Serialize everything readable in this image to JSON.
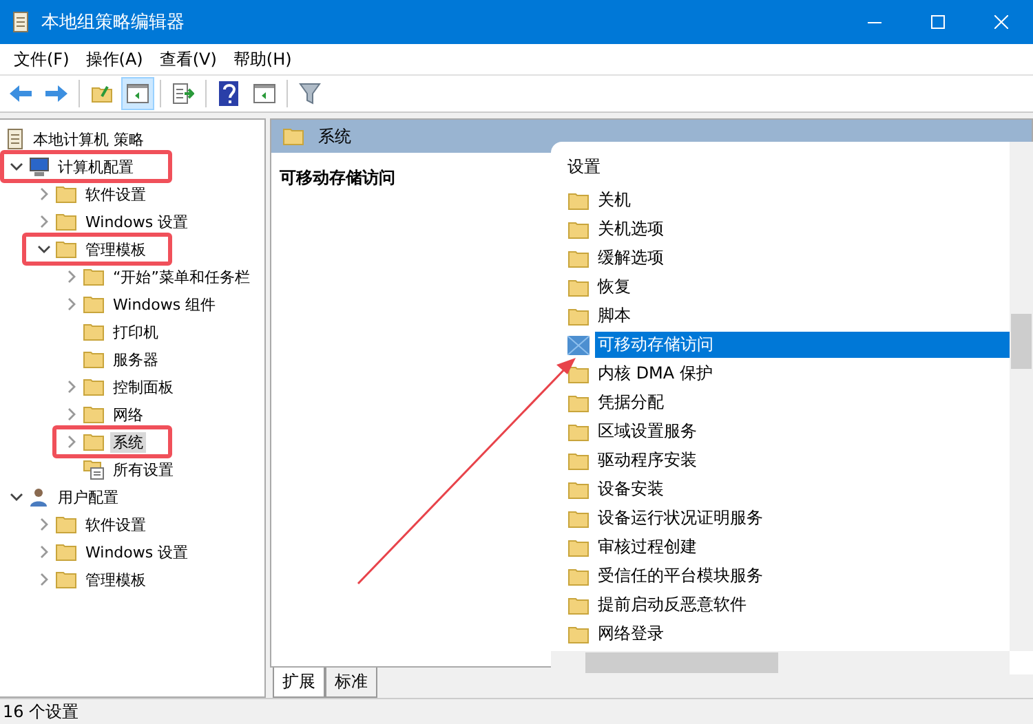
{
  "window": {
    "title": "本地组策略编辑器"
  },
  "menu": [
    "文件(F)",
    "操作(A)",
    "查看(V)",
    "帮助(H)"
  ],
  "toolbar": [
    {
      "kind": "back",
      "pressed": false
    },
    {
      "kind": "forward",
      "pressed": false
    },
    {
      "kind": "sep"
    },
    {
      "kind": "up",
      "pressed": false
    },
    {
      "kind": "pane",
      "pressed": true
    },
    {
      "kind": "sep"
    },
    {
      "kind": "export",
      "pressed": false
    },
    {
      "kind": "sep"
    },
    {
      "kind": "help",
      "pressed": false
    },
    {
      "kind": "pane2",
      "pressed": false
    },
    {
      "kind": "sep"
    },
    {
      "kind": "filter",
      "pressed": false
    }
  ],
  "tree": [
    {
      "label": "本地计算机 策略",
      "kind": "policy",
      "highlighted": false,
      "selected": false,
      "children": [
        {
          "label": "计算机配置",
          "kind": "computer",
          "expanded": true,
          "highlighted": true,
          "selected": false,
          "children": [
            {
              "label": "软件设置",
              "kind": "folder",
              "expanded": false,
              "highlighted": false,
              "selected": false
            },
            {
              "label": "Windows 设置",
              "kind": "folder",
              "expanded": false,
              "highlighted": false,
              "selected": false
            },
            {
              "label": "管理模板",
              "kind": "folder",
              "expanded": true,
              "highlighted": true,
              "selected": false,
              "children": [
                {
                  "label": "“开始”菜单和任务栏",
                  "kind": "folder",
                  "expanded": false,
                  "highlighted": false,
                  "selected": false
                },
                {
                  "label": "Windows 组件",
                  "kind": "folder",
                  "expanded": false,
                  "highlighted": false,
                  "selected": false
                },
                {
                  "label": "打印机",
                  "kind": "folder",
                  "highlighted": false,
                  "selected": false
                },
                {
                  "label": "服务器",
                  "kind": "folder",
                  "highlighted": false,
                  "selected": false
                },
                {
                  "label": "控制面板",
                  "kind": "folder",
                  "expanded": false,
                  "highlighted": false,
                  "selected": false
                },
                {
                  "label": "网络",
                  "kind": "folder",
                  "expanded": false,
                  "highlighted": false,
                  "selected": false
                },
                {
                  "label": "系统",
                  "kind": "folder",
                  "expanded": false,
                  "highlighted": true,
                  "selected": true
                },
                {
                  "label": "所有设置",
                  "kind": "settings",
                  "highlighted": false,
                  "selected": false
                }
              ]
            }
          ]
        },
        {
          "label": "用户配置",
          "kind": "user",
          "expanded": true,
          "highlighted": false,
          "selected": false,
          "children": [
            {
              "label": "软件设置",
              "kind": "folder",
              "expanded": false,
              "highlighted": false,
              "selected": false
            },
            {
              "label": "Windows 设置",
              "kind": "folder",
              "expanded": false,
              "highlighted": false,
              "selected": false
            },
            {
              "label": "管理模板",
              "kind": "folder",
              "expanded": false,
              "highlighted": false,
              "selected": false
            }
          ]
        }
      ]
    }
  ],
  "details": {
    "header": "系统",
    "selected_title": "可移动存储访问",
    "column": "设置",
    "items": [
      {
        "label": "关机",
        "kind": "folder",
        "selected": false
      },
      {
        "label": "关机选项",
        "kind": "folder",
        "selected": false
      },
      {
        "label": "缓解选项",
        "kind": "folder",
        "selected": false
      },
      {
        "label": "恢复",
        "kind": "folder",
        "selected": false
      },
      {
        "label": "脚本",
        "kind": "folder",
        "selected": false
      },
      {
        "label": "可移动存储访问",
        "kind": "policy",
        "selected": true
      },
      {
        "label": "内核 DMA 保护",
        "kind": "folder",
        "selected": false
      },
      {
        "label": "凭据分配",
        "kind": "folder",
        "selected": false
      },
      {
        "label": "区域设置服务",
        "kind": "folder",
        "selected": false
      },
      {
        "label": "驱动程序安装",
        "kind": "folder",
        "selected": false
      },
      {
        "label": "设备安装",
        "kind": "folder",
        "selected": false
      },
      {
        "label": "设备运行状况证明服务",
        "kind": "folder",
        "selected": false
      },
      {
        "label": "审核过程创建",
        "kind": "folder",
        "selected": false
      },
      {
        "label": "受信任的平台模块服务",
        "kind": "folder",
        "selected": false
      },
      {
        "label": "提前启动反恶意软件",
        "kind": "folder",
        "selected": false
      },
      {
        "label": "网络登录",
        "kind": "folder",
        "selected": false
      }
    ],
    "tabs": [
      {
        "label": "扩展",
        "selected": true
      },
      {
        "label": "标准",
        "selected": false
      }
    ]
  },
  "status_bar": "16 个设置"
}
